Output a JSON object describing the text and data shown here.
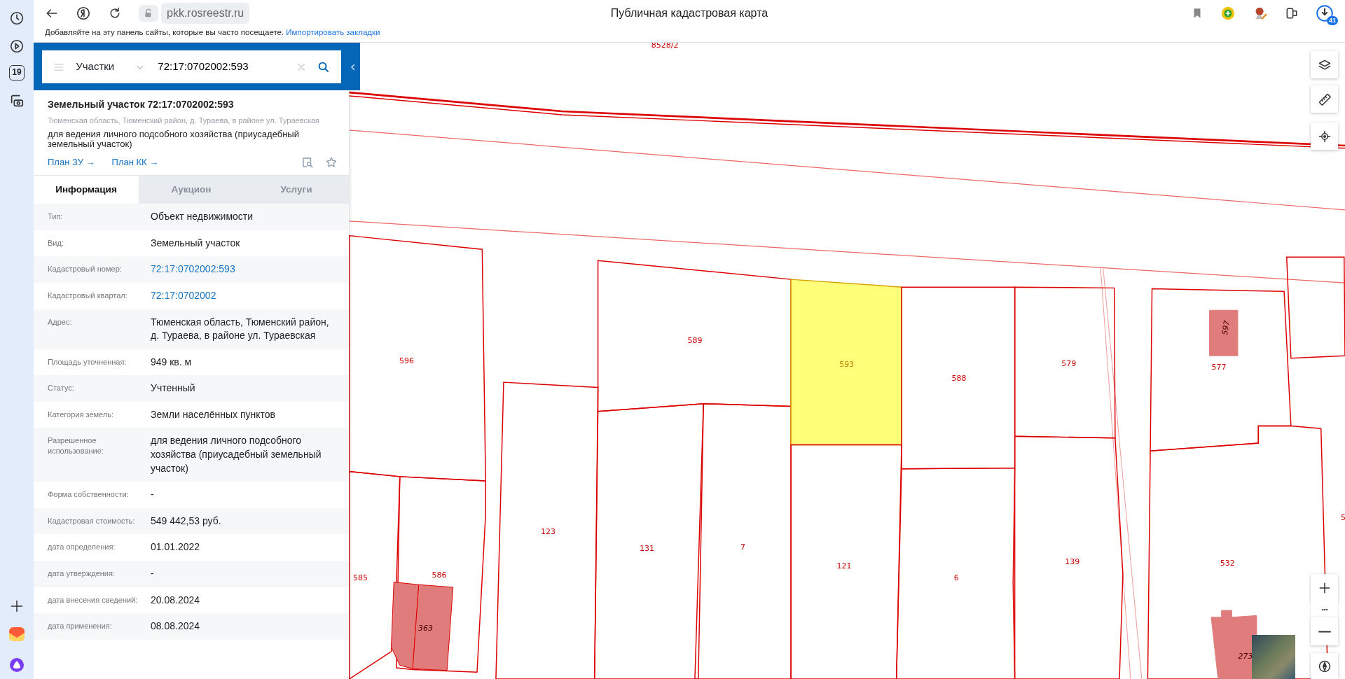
{
  "browser": {
    "address": "pkk.rosreestr.ru",
    "page_title": "Публичная кадастровая карта",
    "calendar_day": "19",
    "downloads_badge": "41",
    "bookmarks_hint": "Добавляйте на эту панель сайты, которые вы часто посещаете.",
    "bookmarks_import_link": "Импортировать закладки"
  },
  "search": {
    "category": "Участки",
    "query": "72:17:0702002:593"
  },
  "object": {
    "title": "Земельный участок 72:17:0702002:593",
    "address": "Тюменская область, Тюменский район, д. Тураева, в районе ул. Тураевская",
    "use": "для ведения личного подсобного хозяйства (приусадебный земельный участок)",
    "links": [
      "План ЗУ →",
      "План КК →"
    ]
  },
  "tabs": [
    {
      "label": "Информация",
      "selected": true
    },
    {
      "label": "Аукцион",
      "selected": false
    },
    {
      "label": "Услуги",
      "selected": false
    }
  ],
  "properties": [
    {
      "label": "Тип:",
      "value": "Объект недвижимости",
      "kind": "text"
    },
    {
      "label": "Вид:",
      "value": "Земельный участок",
      "kind": "text"
    },
    {
      "label": "Кадастровый номер:",
      "value": "72:17:0702002:593",
      "kind": "link"
    },
    {
      "label": "Кадастровый квартал:",
      "value": "72:17:0702002",
      "kind": "link"
    },
    {
      "label": "Адрес:",
      "value": "Тюменская область, Тюменский район, д. Тураева, в районе ул. Тураевская",
      "kind": "text"
    },
    {
      "label": "Площадь уточненная:",
      "value": "949 кв. м",
      "kind": "text"
    },
    {
      "label": "Статус:",
      "value": "Учтенный",
      "kind": "text"
    },
    {
      "label": "Категория земель:",
      "value": "Земли населённых пунктов",
      "kind": "text"
    },
    {
      "label": "Разрешенное использование:",
      "value": "для ведения личного подсобного хозяйства (приусадебный земельный участок)",
      "kind": "text"
    },
    {
      "label": "Форма собственности:",
      "value": "-",
      "kind": "text"
    },
    {
      "label": "Кадастровая стоимость:",
      "value": "549 442,53 руб.",
      "kind": "text"
    },
    {
      "label": "дата определения:",
      "value": "01.01.2022",
      "kind": "text"
    },
    {
      "label": "дата утверждения:",
      "value": "-",
      "kind": "text"
    },
    {
      "label": "дата внесения сведений:",
      "value": "20.08.2024",
      "kind": "text"
    },
    {
      "label": "дата применения:",
      "value": "08.08.2024",
      "kind": "text"
    }
  ],
  "map": {
    "top_label": "8528/2",
    "edge_label": "5",
    "parcels": [
      {
        "label": "596",
        "selected": false
      },
      {
        "label": "585",
        "selected": false
      },
      {
        "label": "586",
        "selected": false
      },
      {
        "label": "123",
        "selected": false
      },
      {
        "label": "589",
        "selected": false
      },
      {
        "label": "131",
        "selected": false
      },
      {
        "label": "7",
        "selected": false
      },
      {
        "label": "593",
        "selected": true
      },
      {
        "label": "121",
        "selected": false
      },
      {
        "label": "588",
        "selected": false
      },
      {
        "label": "6",
        "selected": false
      },
      {
        "label": "579",
        "selected": false
      },
      {
        "label": "139",
        "selected": false
      },
      {
        "label": "577",
        "selected": false
      },
      {
        "label": "532",
        "selected": false
      }
    ],
    "buildings": [
      {
        "label": "363"
      },
      {
        "label": "597"
      },
      {
        "label": "273"
      }
    ]
  }
}
